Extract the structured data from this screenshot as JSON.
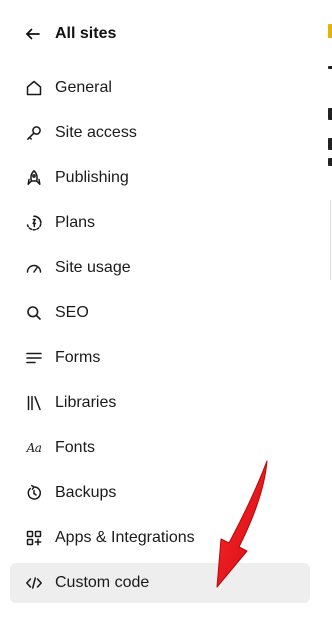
{
  "back": {
    "label": "All sites",
    "icon": "arrow-left-icon"
  },
  "nav": {
    "items": [
      {
        "label": "General",
        "icon": "home-icon",
        "active": false
      },
      {
        "label": "Site access",
        "icon": "key-icon",
        "active": false
      },
      {
        "label": "Publishing",
        "icon": "rocket-icon",
        "active": false
      },
      {
        "label": "Plans",
        "icon": "plans-icon",
        "active": false
      },
      {
        "label": "Site usage",
        "icon": "gauge-icon",
        "active": false
      },
      {
        "label": "SEO",
        "icon": "search-icon",
        "active": false
      },
      {
        "label": "Forms",
        "icon": "forms-icon",
        "active": false
      },
      {
        "label": "Libraries",
        "icon": "libraries-icon",
        "active": false
      },
      {
        "label": "Fonts",
        "icon": "fonts-icon",
        "active": false
      },
      {
        "label": "Backups",
        "icon": "backup-icon",
        "active": false
      },
      {
        "label": "Apps & Integrations",
        "icon": "apps-icon",
        "active": false
      },
      {
        "label": "Custom code",
        "icon": "code-icon",
        "active": true
      }
    ],
    "fonts_icon_text": "Aa"
  },
  "annotation": {
    "icon": "red-arrow-icon",
    "color": "#e8141c"
  },
  "colors": {
    "active_bg": "#eeeeee",
    "text": "#1a1a1a",
    "accent_edge": "#e8b200"
  }
}
